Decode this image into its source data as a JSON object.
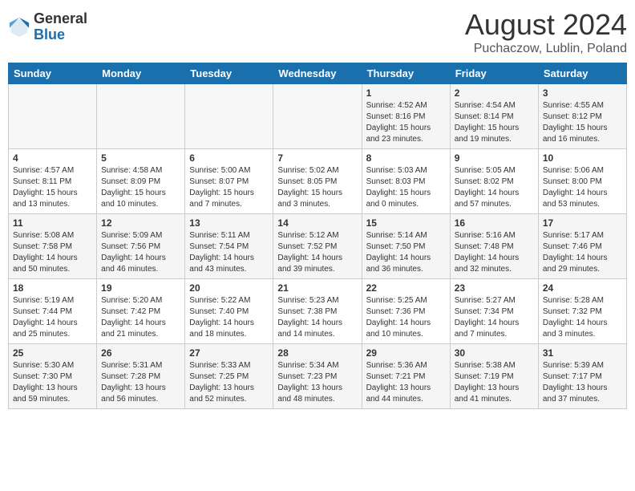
{
  "header": {
    "logo_general": "General",
    "logo_blue": "Blue",
    "title": "August 2024",
    "location": "Puchaczow, Lublin, Poland"
  },
  "days_of_week": [
    "Sunday",
    "Monday",
    "Tuesday",
    "Wednesday",
    "Thursday",
    "Friday",
    "Saturday"
  ],
  "weeks": [
    [
      {
        "day": "",
        "sunrise": "",
        "sunset": "",
        "daylight": ""
      },
      {
        "day": "",
        "sunrise": "",
        "sunset": "",
        "daylight": ""
      },
      {
        "day": "",
        "sunrise": "",
        "sunset": "",
        "daylight": ""
      },
      {
        "day": "",
        "sunrise": "",
        "sunset": "",
        "daylight": ""
      },
      {
        "day": "1",
        "sunrise": "Sunrise: 4:52 AM",
        "sunset": "Sunset: 8:16 PM",
        "daylight": "Daylight: 15 hours and 23 minutes."
      },
      {
        "day": "2",
        "sunrise": "Sunrise: 4:54 AM",
        "sunset": "Sunset: 8:14 PM",
        "daylight": "Daylight: 15 hours and 19 minutes."
      },
      {
        "day": "3",
        "sunrise": "Sunrise: 4:55 AM",
        "sunset": "Sunset: 8:12 PM",
        "daylight": "Daylight: 15 hours and 16 minutes."
      }
    ],
    [
      {
        "day": "4",
        "sunrise": "Sunrise: 4:57 AM",
        "sunset": "Sunset: 8:11 PM",
        "daylight": "Daylight: 15 hours and 13 minutes."
      },
      {
        "day": "5",
        "sunrise": "Sunrise: 4:58 AM",
        "sunset": "Sunset: 8:09 PM",
        "daylight": "Daylight: 15 hours and 10 minutes."
      },
      {
        "day": "6",
        "sunrise": "Sunrise: 5:00 AM",
        "sunset": "Sunset: 8:07 PM",
        "daylight": "Daylight: 15 hours and 7 minutes."
      },
      {
        "day": "7",
        "sunrise": "Sunrise: 5:02 AM",
        "sunset": "Sunset: 8:05 PM",
        "daylight": "Daylight: 15 hours and 3 minutes."
      },
      {
        "day": "8",
        "sunrise": "Sunrise: 5:03 AM",
        "sunset": "Sunset: 8:03 PM",
        "daylight": "Daylight: 15 hours and 0 minutes."
      },
      {
        "day": "9",
        "sunrise": "Sunrise: 5:05 AM",
        "sunset": "Sunset: 8:02 PM",
        "daylight": "Daylight: 14 hours and 57 minutes."
      },
      {
        "day": "10",
        "sunrise": "Sunrise: 5:06 AM",
        "sunset": "Sunset: 8:00 PM",
        "daylight": "Daylight: 14 hours and 53 minutes."
      }
    ],
    [
      {
        "day": "11",
        "sunrise": "Sunrise: 5:08 AM",
        "sunset": "Sunset: 7:58 PM",
        "daylight": "Daylight: 14 hours and 50 minutes."
      },
      {
        "day": "12",
        "sunrise": "Sunrise: 5:09 AM",
        "sunset": "Sunset: 7:56 PM",
        "daylight": "Daylight: 14 hours and 46 minutes."
      },
      {
        "day": "13",
        "sunrise": "Sunrise: 5:11 AM",
        "sunset": "Sunset: 7:54 PM",
        "daylight": "Daylight: 14 hours and 43 minutes."
      },
      {
        "day": "14",
        "sunrise": "Sunrise: 5:12 AM",
        "sunset": "Sunset: 7:52 PM",
        "daylight": "Daylight: 14 hours and 39 minutes."
      },
      {
        "day": "15",
        "sunrise": "Sunrise: 5:14 AM",
        "sunset": "Sunset: 7:50 PM",
        "daylight": "Daylight: 14 hours and 36 minutes."
      },
      {
        "day": "16",
        "sunrise": "Sunrise: 5:16 AM",
        "sunset": "Sunset: 7:48 PM",
        "daylight": "Daylight: 14 hours and 32 minutes."
      },
      {
        "day": "17",
        "sunrise": "Sunrise: 5:17 AM",
        "sunset": "Sunset: 7:46 PM",
        "daylight": "Daylight: 14 hours and 29 minutes."
      }
    ],
    [
      {
        "day": "18",
        "sunrise": "Sunrise: 5:19 AM",
        "sunset": "Sunset: 7:44 PM",
        "daylight": "Daylight: 14 hours and 25 minutes."
      },
      {
        "day": "19",
        "sunrise": "Sunrise: 5:20 AM",
        "sunset": "Sunset: 7:42 PM",
        "daylight": "Daylight: 14 hours and 21 minutes."
      },
      {
        "day": "20",
        "sunrise": "Sunrise: 5:22 AM",
        "sunset": "Sunset: 7:40 PM",
        "daylight": "Daylight: 14 hours and 18 minutes."
      },
      {
        "day": "21",
        "sunrise": "Sunrise: 5:23 AM",
        "sunset": "Sunset: 7:38 PM",
        "daylight": "Daylight: 14 hours and 14 minutes."
      },
      {
        "day": "22",
        "sunrise": "Sunrise: 5:25 AM",
        "sunset": "Sunset: 7:36 PM",
        "daylight": "Daylight: 14 hours and 10 minutes."
      },
      {
        "day": "23",
        "sunrise": "Sunrise: 5:27 AM",
        "sunset": "Sunset: 7:34 PM",
        "daylight": "Daylight: 14 hours and 7 minutes."
      },
      {
        "day": "24",
        "sunrise": "Sunrise: 5:28 AM",
        "sunset": "Sunset: 7:32 PM",
        "daylight": "Daylight: 14 hours and 3 minutes."
      }
    ],
    [
      {
        "day": "25",
        "sunrise": "Sunrise: 5:30 AM",
        "sunset": "Sunset: 7:30 PM",
        "daylight": "Daylight: 13 hours and 59 minutes."
      },
      {
        "day": "26",
        "sunrise": "Sunrise: 5:31 AM",
        "sunset": "Sunset: 7:28 PM",
        "daylight": "Daylight: 13 hours and 56 minutes."
      },
      {
        "day": "27",
        "sunrise": "Sunrise: 5:33 AM",
        "sunset": "Sunset: 7:25 PM",
        "daylight": "Daylight: 13 hours and 52 minutes."
      },
      {
        "day": "28",
        "sunrise": "Sunrise: 5:34 AM",
        "sunset": "Sunset: 7:23 PM",
        "daylight": "Daylight: 13 hours and 48 minutes."
      },
      {
        "day": "29",
        "sunrise": "Sunrise: 5:36 AM",
        "sunset": "Sunset: 7:21 PM",
        "daylight": "Daylight: 13 hours and 44 minutes."
      },
      {
        "day": "30",
        "sunrise": "Sunrise: 5:38 AM",
        "sunset": "Sunset: 7:19 PM",
        "daylight": "Daylight: 13 hours and 41 minutes."
      },
      {
        "day": "31",
        "sunrise": "Sunrise: 5:39 AM",
        "sunset": "Sunset: 7:17 PM",
        "daylight": "Daylight: 13 hours and 37 minutes."
      }
    ]
  ]
}
